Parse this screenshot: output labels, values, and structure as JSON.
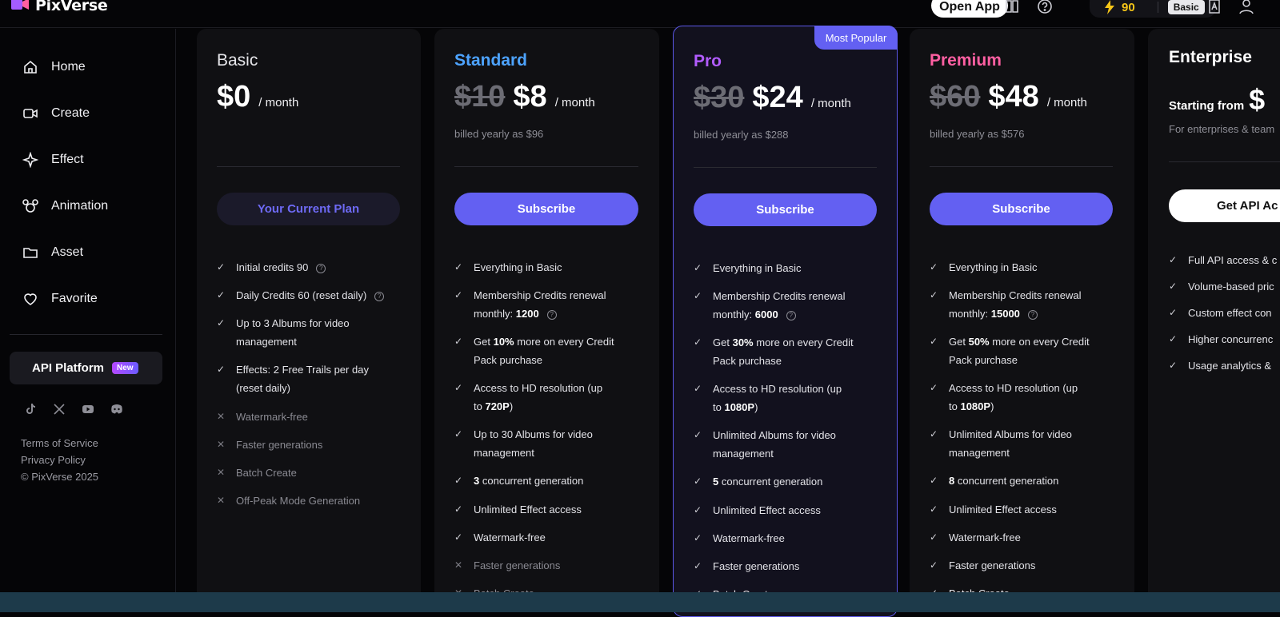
{
  "app": {
    "name": "PixVerse"
  },
  "topbar": {
    "open_app": "Open App",
    "credits": "90",
    "plan_badge": "Basic"
  },
  "sidebar": {
    "items": [
      {
        "label": "Home"
      },
      {
        "label": "Create"
      },
      {
        "label": "Effect"
      },
      {
        "label": "Animation"
      },
      {
        "label": "Asset"
      },
      {
        "label": "Favorite"
      }
    ],
    "api_platform": "API Platform",
    "api_new": "New",
    "links": [
      "Terms of Service",
      "Privacy Policy",
      "© PixVerse 2025"
    ]
  },
  "plans": {
    "basic": {
      "title": "Basic",
      "price": "$0",
      "per": "/ month",
      "button": "Your Current Plan",
      "features": [
        "Initial credits 90",
        "Daily Credits 60 (reset daily)",
        "Up to 3 Albums for video",
        "management",
        "Effects: 2 Free Trails per day",
        "(reset daily)",
        "Watermark-free",
        "Faster generations",
        "Batch Create",
        "Off-Peak Mode Generation"
      ]
    },
    "standard": {
      "title": "Standard",
      "old_price": "$10",
      "price": "$8",
      "per": "/ month",
      "billed": "billed yearly as $96",
      "button": "Subscribe",
      "features": [
        "Everything in Basic",
        "Membership Credits renewal",
        "monthly:",
        "1200",
        "Get",
        "10%",
        "more on every Credit",
        "Pack purchase",
        "Access to HD resolution (up",
        "to",
        "720P",
        ")",
        "Up to 30 Albums for video",
        "management",
        "3",
        "concurrent generation",
        "Unlimited Effect access",
        "Watermark-free",
        "Faster generations",
        "Batch Create"
      ]
    },
    "pro": {
      "badge": "Most Popular",
      "title": "Pro",
      "old_price": "$30",
      "price": "$24",
      "per": "/ month",
      "billed": "billed yearly as $288",
      "button": "Subscribe",
      "features": [
        "Everything in Basic",
        "Membership Credits renewal",
        "monthly:",
        "6000",
        "Get",
        "30%",
        "more on every Credit",
        "Pack purchase",
        "Access to HD resolution (up",
        "to",
        "1080P",
        ")",
        "Unlimited Albums for video",
        "management",
        "5",
        "concurrent generation",
        "Unlimited Effect access",
        "Watermark-free",
        "Faster generations",
        "Batch Create"
      ]
    },
    "premium": {
      "title": "Premium",
      "old_price": "$60",
      "price": "$48",
      "per": "/ month",
      "billed": "billed yearly as $576",
      "button": "Subscribe",
      "features": [
        "Everything in Basic",
        "Membership Credits renewal",
        "monthly:",
        "15000",
        "Get",
        "50%",
        "more on every Credit",
        "Pack purchase",
        "Access to HD resolution (up",
        "to",
        "1080P",
        ")",
        "Unlimited Albums for video",
        "management",
        "8",
        "concurrent generation",
        "Unlimited Effect access",
        "Watermark-free",
        "Faster generations",
        "Batch Create"
      ]
    },
    "enterprise": {
      "title": "Enterprise",
      "starting": "Starting from",
      "price": "$",
      "sub": "For enterprises & team",
      "button": "Get API Ac",
      "features": [
        "Full API access & c",
        "Volume-based pric",
        "Custom effect con",
        "Higher concurrenc",
        "Usage analytics &"
      ]
    }
  },
  "colors": {
    "accent": "#6360f2",
    "standard": "#4da3ff",
    "pro": "#b25cff",
    "premium": "#ff5fa2",
    "credits": "#f5c518"
  }
}
